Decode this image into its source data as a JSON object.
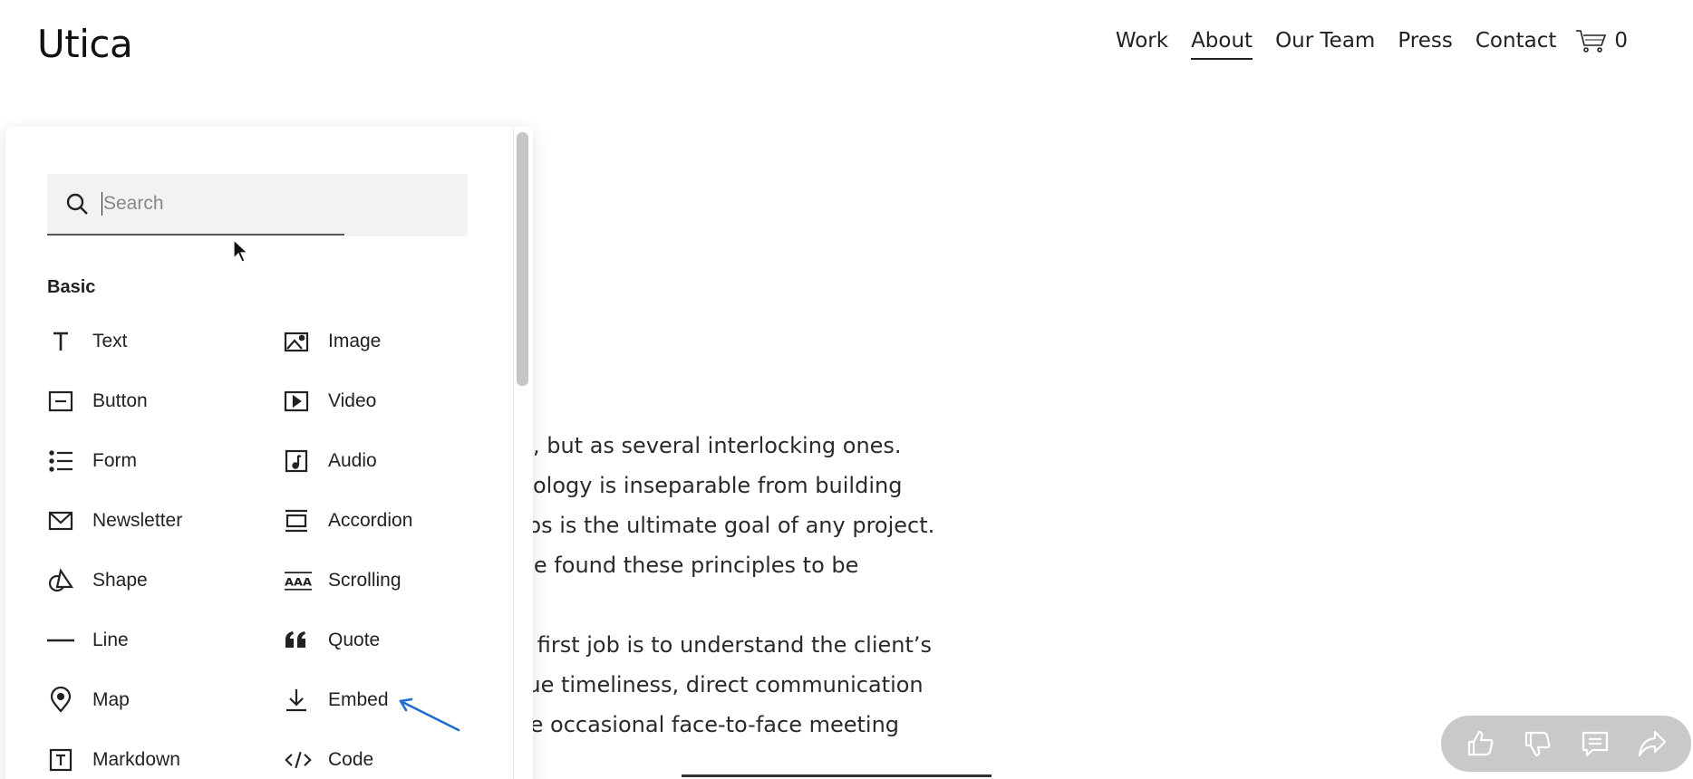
{
  "site": {
    "title": "Utica"
  },
  "nav": {
    "items": [
      {
        "label": "Work"
      },
      {
        "label": "About"
      },
      {
        "label": "Our Team"
      },
      {
        "label": "Press"
      },
      {
        "label": "Contact"
      }
    ],
    "active": "About",
    "cart_count": "0"
  },
  "content": {
    "lines": [
      "ce, but as several interlocking ones.",
      "ecology is inseparable from building",
      "hips is the ultimate goal of any project.",
      "ave found these principles to be",
      "",
      "ur first job is to understand the client’s",
      "alue timeliness, direct communication",
      "the occasional face-to-face meeting"
    ]
  },
  "panel": {
    "search": {
      "placeholder": "Search",
      "value": ""
    },
    "section": "Basic",
    "blocks": [
      {
        "label": "Text",
        "icon": "text-icon"
      },
      {
        "label": "Image",
        "icon": "image-icon"
      },
      {
        "label": "Button",
        "icon": "button-icon"
      },
      {
        "label": "Video",
        "icon": "video-icon"
      },
      {
        "label": "Form",
        "icon": "form-icon"
      },
      {
        "label": "Audio",
        "icon": "audio-icon"
      },
      {
        "label": "Newsletter",
        "icon": "newsletter-icon"
      },
      {
        "label": "Accordion",
        "icon": "accordion-icon"
      },
      {
        "label": "Shape",
        "icon": "shape-icon"
      },
      {
        "label": "Scrolling",
        "icon": "scrolling-icon"
      },
      {
        "label": "Line",
        "icon": "line-icon"
      },
      {
        "label": "Quote",
        "icon": "quote-icon"
      },
      {
        "label": "Map",
        "icon": "map-icon"
      },
      {
        "label": "Embed",
        "icon": "embed-icon"
      },
      {
        "label": "Markdown",
        "icon": "markdown-icon"
      },
      {
        "label": "Code",
        "icon": "code-icon"
      }
    ],
    "scrolling_icon_text": "AAA"
  },
  "colors": {
    "annotation": "#1f6fd1",
    "feedback_bg": "#c9c9c9",
    "search_bg": "#f2f2f2"
  }
}
